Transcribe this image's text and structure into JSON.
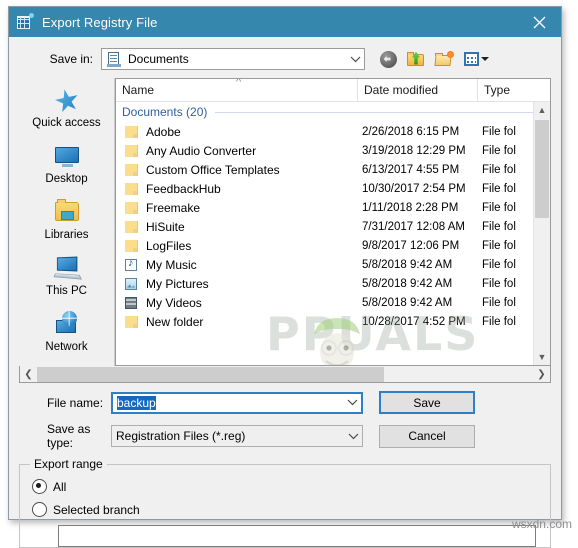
{
  "window": {
    "title": "Export Registry File",
    "icon": "registry-editor-icon",
    "close_label": "✕",
    "titlebar_color": "#3587ad"
  },
  "savein": {
    "label": "Save in:",
    "value": "Documents",
    "icon": "documents-folder-icon"
  },
  "toolbar": {
    "back": "back-icon",
    "up": "up-one-level-icon",
    "new_folder": "new-folder-icon",
    "views": "views-icon"
  },
  "places": {
    "items": [
      {
        "label": "Quick access",
        "icon": "star-icon"
      },
      {
        "label": "Desktop",
        "icon": "monitor-icon"
      },
      {
        "label": "Libraries",
        "icon": "libraries-icon"
      },
      {
        "label": "This PC",
        "icon": "computer-icon"
      },
      {
        "label": "Network",
        "icon": "network-globe-icon"
      }
    ]
  },
  "filelist": {
    "columns": [
      "Name",
      "Date modified",
      "Type"
    ],
    "sort_indicator": "^",
    "group_header": "Documents (20)",
    "rows": [
      {
        "name": "Adobe",
        "date": "2/26/2018 6:15 PM",
        "type": "File fol",
        "icon": "folder"
      },
      {
        "name": "Any Audio Converter",
        "date": "3/19/2018 12:29 PM",
        "type": "File fol",
        "icon": "folder"
      },
      {
        "name": "Custom Office Templates",
        "date": "6/13/2017 4:55 PM",
        "type": "File fol",
        "icon": "folder"
      },
      {
        "name": "FeedbackHub",
        "date": "10/30/2017 2:54 PM",
        "type": "File fol",
        "icon": "folder"
      },
      {
        "name": "Freemake",
        "date": "1/11/2018 2:28 PM",
        "type": "File fol",
        "icon": "folder"
      },
      {
        "name": "HiSuite",
        "date": "7/31/2017 12:08 AM",
        "type": "File fol",
        "icon": "folder"
      },
      {
        "name": "LogFiles",
        "date": "9/8/2017 12:06 PM",
        "type": "File fol",
        "icon": "folder"
      },
      {
        "name": "My Music",
        "date": "5/8/2018 9:42 AM",
        "type": "File fol",
        "icon": "music"
      },
      {
        "name": "My Pictures",
        "date": "5/8/2018 9:42 AM",
        "type": "File fol",
        "icon": "picture"
      },
      {
        "name": "My Videos",
        "date": "5/8/2018 9:42 AM",
        "type": "File fol",
        "icon": "video"
      },
      {
        "name": "New folder",
        "date": "10/28/2017 4:52 PM",
        "type": "File fol",
        "icon": "folder"
      }
    ]
  },
  "form": {
    "filename_label": "File name:",
    "filename_value": "backup",
    "savetype_label": "Save as type:",
    "savetype_value": "Registration Files (*.reg)",
    "save_button": "Save",
    "cancel_button": "Cancel"
  },
  "export_range": {
    "legend": "Export range",
    "option_all": "All",
    "option_selected_branch": "Selected branch",
    "selected": "All",
    "branch_value": ""
  },
  "watermarks": {
    "appuals": "PPUALS",
    "wsxdn": "wsxdn.com"
  }
}
